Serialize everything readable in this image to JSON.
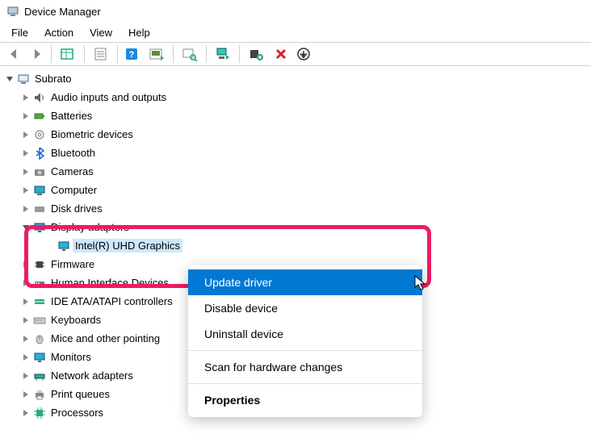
{
  "window": {
    "title": "Device Manager"
  },
  "menubar": {
    "file": "File",
    "action": "Action",
    "view": "View",
    "help": "Help"
  },
  "toolbar": {
    "back": "back",
    "forward": "forward",
    "show_hidden": "show-hidden",
    "properties": "properties",
    "help_btn": "help",
    "action_center": "action",
    "print": "print",
    "scan": "scan",
    "add_legacy": "add-legacy",
    "remove": "remove",
    "update": "update"
  },
  "tree": {
    "root": "Subrato",
    "items": [
      {
        "label": "Audio inputs and outputs",
        "icon": "audio"
      },
      {
        "label": "Batteries",
        "icon": "battery"
      },
      {
        "label": "Biometric devices",
        "icon": "biometric"
      },
      {
        "label": "Bluetooth",
        "icon": "bluetooth"
      },
      {
        "label": "Cameras",
        "icon": "camera"
      },
      {
        "label": "Computer",
        "icon": "computer"
      },
      {
        "label": "Disk drives",
        "icon": "disk"
      },
      {
        "label": "Display adapters",
        "icon": "display",
        "expanded": true,
        "children": [
          {
            "label": "Intel(R) UHD Graphics",
            "icon": "display",
            "selected": true
          }
        ]
      },
      {
        "label": "Firmware",
        "icon": "firmware"
      },
      {
        "label": "Human Interface Devices",
        "icon": "hid"
      },
      {
        "label": "IDE ATA/ATAPI controllers",
        "icon": "ide"
      },
      {
        "label": "Keyboards",
        "icon": "keyboard"
      },
      {
        "label": "Mice and other pointing devices",
        "icon": "mouse",
        "truncated": "Mice and other pointing"
      },
      {
        "label": "Monitors",
        "icon": "monitor"
      },
      {
        "label": "Network adapters",
        "icon": "network"
      },
      {
        "label": "Print queues",
        "icon": "printer"
      },
      {
        "label": "Processors",
        "icon": "processor"
      }
    ]
  },
  "context_menu": {
    "update": "Update driver",
    "disable": "Disable device",
    "uninstall": "Uninstall device",
    "scan": "Scan for hardware changes",
    "properties": "Properties"
  }
}
